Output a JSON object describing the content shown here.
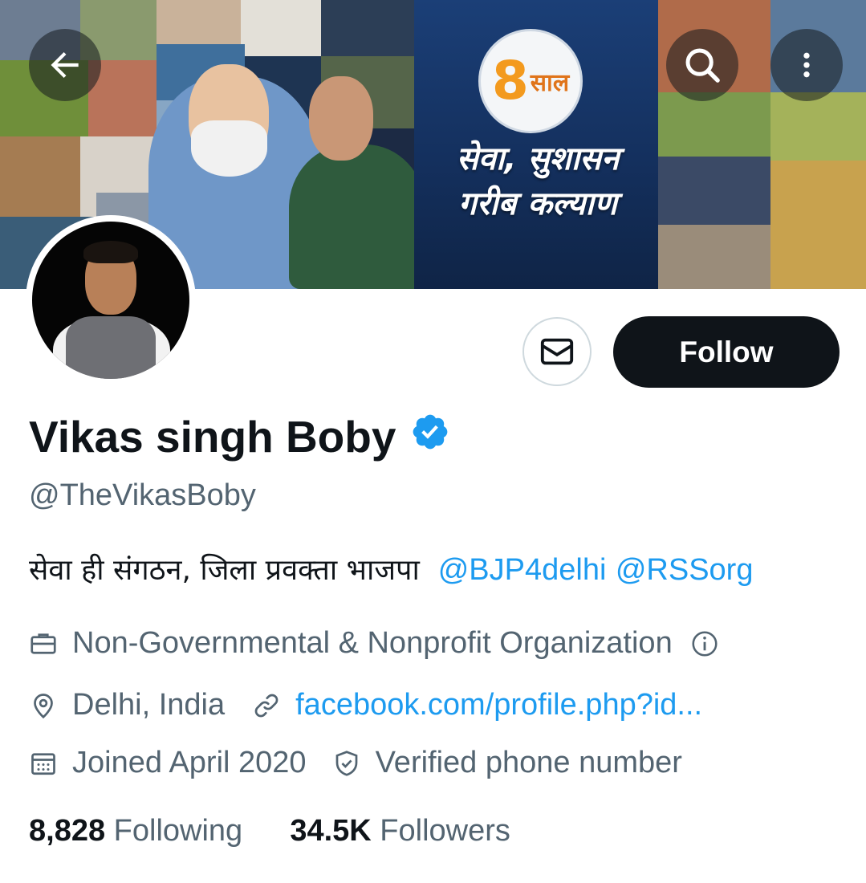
{
  "banner": {
    "badge_number": "8",
    "badge_word": "साल",
    "line1": "सेवा, सुशासन",
    "line2": "गरीब कल्याण"
  },
  "nav": {
    "back_icon": "arrow-left-icon",
    "search_icon": "search-icon",
    "more_icon": "more-vertical-icon"
  },
  "actions": {
    "message_icon": "envelope-icon",
    "follow_label": "Follow"
  },
  "profile": {
    "display_name": "Vikas singh Boby",
    "handle": "@TheVikasBoby",
    "bio_text": "सेवा ही संगठन, जिला प्रवक्ता भाजपा",
    "bio_mention_1": "@BJP4delhi",
    "bio_mention_2": "@RSSorg",
    "category": "Non-Governmental & Nonprofit Organization",
    "location": "Delhi, India",
    "website": "facebook.com/profile.php?id...",
    "joined": "Joined April 2020",
    "verified_phone": "Verified phone number"
  },
  "stats": {
    "following_count": "8,828",
    "following_label": "Following",
    "followers_count": "34.5K",
    "followers_label": "Followers"
  },
  "colors": {
    "text": "#0f1419",
    "secondary": "#536471",
    "link": "#1d9bf0",
    "button": "#0f1419"
  }
}
